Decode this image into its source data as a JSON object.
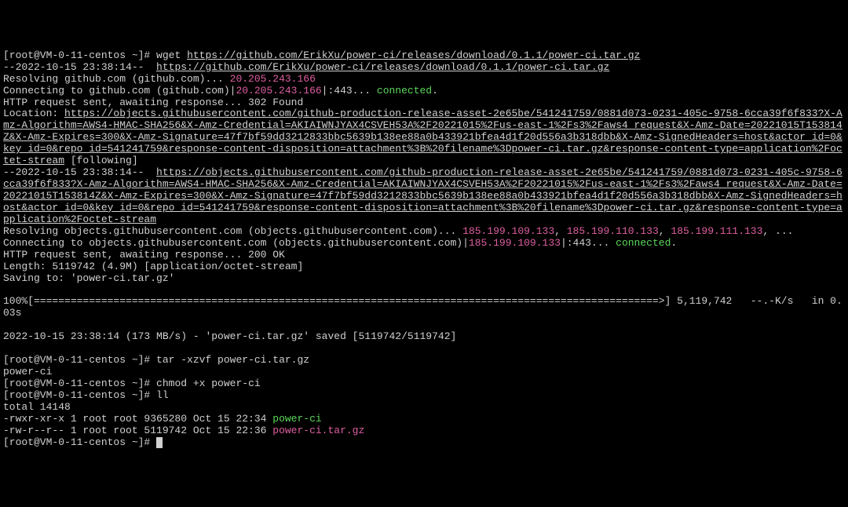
{
  "prompt": "[root@VM-0-11-centos ~]# ",
  "wget": {
    "cmd": "wget ",
    "url": "https://github.com/ErikXu/power-ci/releases/download/0.1.1/power-ci.tar.gz",
    "ts": "--2022-10-15 23:38:14--  ",
    "url2": "https://github.com/ErikXu/power-ci/releases/download/0.1.1/power-ci.tar.gz",
    "resolving": "Resolving github.com (github.com)... ",
    "ip1": "20.205.243.166",
    "connecting": "Connecting to github.com (github.com)|",
    "ip2": "20.205.243.166",
    "port": "|:443... ",
    "connected": "connected",
    "dot": ".",
    "http1": "HTTP request sent, awaiting response... 302 Found",
    "loc_label": "Location: ",
    "loc_url": "https://objects.githubusercontent.com/github-production-release-asset-2e65be/541241759/0881d073-0231-405c-9758-6cca39f6f833?X-Amz-Algorithm=AWS4-HMAC-SHA256&X-Amz-Credential=AKIAIWNJYAX4CSVEH53A%2F20221015%2Fus-east-1%2Fs3%2Faws4_request&X-Amz-Date=20221015T153814Z&X-Amz-Expires=300&X-Amz-Signature=47f7bf59dd3212833bbc5639b138ee88a0b433921bfea4d1f20d556a3b318dbb&X-Amz-SignedHeaders=host&actor_id=0&key_id=0&repo_id=541241759&response-content-disposition=attachment%3B%20filename%3Dpower-ci.tar.gz&response-content-type=application%2Foctet-stream",
    "following": " [following]",
    "ts2": "--2022-10-15 23:38:14--  ",
    "loc_url2": "https://objects.githubusercontent.com/github-production-release-asset-2e65be/541241759/0881d073-0231-405c-9758-6cca39f6f833?X-Amz-Algorithm=AWS4-HMAC-SHA256&X-Amz-Credential=AKIAIWNJYAX4CSVEH53A%2F20221015%2Fus-east-1%2Fs3%2Faws4_request&X-Amz-Date=20221015T153814Z&X-Amz-Expires=300&X-Amz-Signature=47f7bf59dd3212833bbc5639b138ee88a0b433921bfea4d1f20d556a3b318dbb&X-Amz-SignedHeaders=host&actor_id=0&key_id=0&repo_id=541241759&response-content-disposition=attachment%3B%20filename%3Dpower-ci.tar.gz&response-content-type=application%2Foctet-stream",
    "resolving2": "Resolving objects.githubusercontent.com (objects.githubusercontent.com)... ",
    "ip_a": "185.199.109.133",
    "sep": ", ",
    "ip_b": "185.199.110.133",
    "ip_c": "185.199.111.133",
    "ellipsis": ", ...",
    "connecting2": "Connecting to objects.githubusercontent.com (objects.githubusercontent.com)|",
    "ip_d": "185.199.109.133",
    "port2": "|:443... ",
    "connected2": "connected",
    "dot2": ".",
    "http2": "HTTP request sent, awaiting response... 200 OK",
    "length": "Length: 5119742 (4.9M) [application/octet-stream]",
    "saving": "Saving to: 'power-ci.tar.gz'",
    "progress": "100%[======================================================================================================>] 5,119,742   --.-K/s   in 0.03s",
    "done": "2022-10-15 23:38:14 (173 MB/s) - 'power-ci.tar.gz' saved [5119742/5119742]"
  },
  "tar": {
    "cmd": "tar -xzvf power-ci.tar.gz",
    "out": "power-ci"
  },
  "chmod": {
    "cmd": "chmod +x power-ci"
  },
  "ll": {
    "cmd": "ll",
    "total": "total 14148",
    "l1_perm": "-rwxr-xr-x 1 root root 9365280 Oct 15 22:34 ",
    "l1_name": "power-ci",
    "l2_perm": "-rw-r--r-- 1 root root 5119742 Oct 15 22:36 ",
    "l2_name": "power-ci.tar.gz"
  }
}
